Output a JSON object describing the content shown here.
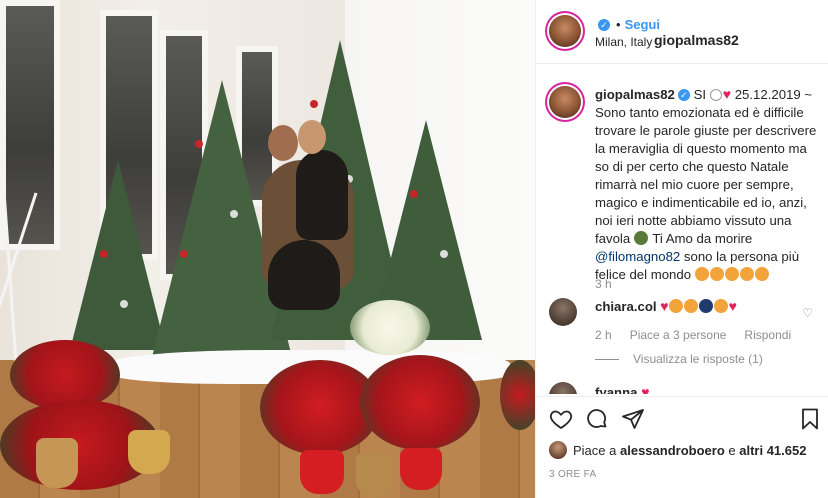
{
  "post": {
    "username": "giopalmas82",
    "follow_label": "Segui",
    "location": "Milan, Italy",
    "caption": {
      "username": "giopalmas82",
      "line_start": "SI",
      "date_text": "25.12.2019 ~",
      "body": "Sono tanto emozionata ed è difficile trovare le parole giuste per descrivere la meraviglia di questo momento ma so di per certo che questo Natale rimarrà nel mio cuore per sempre, magico e indimenticabile ed io, anzi, noi ieri notte abbiamo vissuto una favola",
      "after_emoji": "Ti Amo da morire",
      "mention": "@filomagno82",
      "ending": "sono la persona più felice del mondo",
      "time": "3 h"
    },
    "comments": [
      {
        "username": "chiara.col",
        "time": "2 h",
        "likes": "Piace a 3 persone",
        "reply_label": "Rispondi",
        "replies_label": "Visualizza le risposte (1)"
      },
      {
        "username": "fyanna"
      }
    ],
    "likes": {
      "prefix": "Piace a",
      "user": "alessandroboero",
      "connector": "e",
      "others": "altri 41.652"
    },
    "timestamp": "3 ORE FA",
    "icons": [
      "heart-icon",
      "comment-icon",
      "share-icon",
      "bookmark-icon",
      "verified-icon"
    ],
    "colors": {
      "link": "#3897f0",
      "mention": "#003569",
      "meta": "#8e8e8e",
      "heart": "#e0245e"
    }
  }
}
